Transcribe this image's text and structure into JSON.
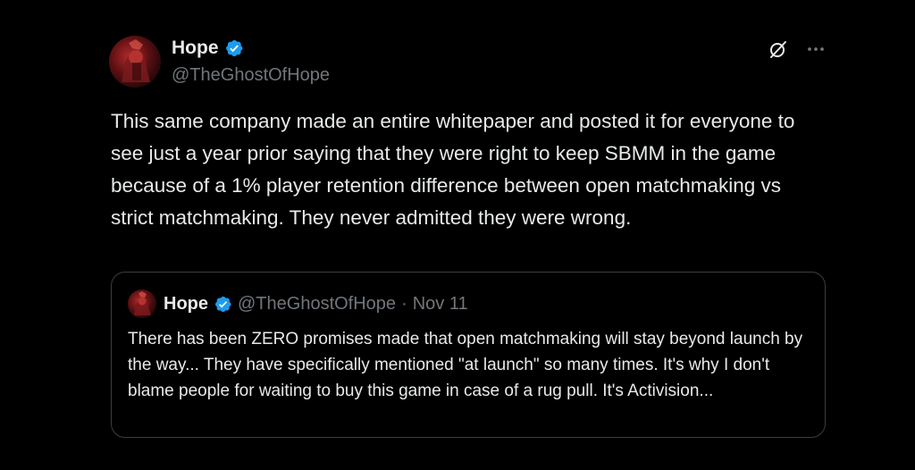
{
  "tweet": {
    "author": {
      "display_name": "Hope",
      "handle": "@TheGhostOfHope",
      "verified": true
    },
    "text": "This same company made an entire whitepaper and posted it for everyone to see just a year prior saying that they were right to keep SBMM in the game because of a 1% player retention difference between open matchmaking vs strict matchmaking. They never admitted they were wrong.",
    "icons": {
      "grok": "grok-icon",
      "more": "more-options-icon"
    },
    "more_label": "···"
  },
  "quote": {
    "author": {
      "display_name": "Hope",
      "handle": "@TheGhostOfHope",
      "verified": true
    },
    "separator": "·",
    "date": "Nov 11",
    "text": "There has been ZERO promises made that open matchmaking will stay beyond launch by the way... They have specifically mentioned \"at launch\" so many times. It's why I don't blame people for waiting to buy this game in case of a rug pull. It's Activision..."
  },
  "colors": {
    "background": "#000000",
    "text_primary": "#e7e9ea",
    "text_secondary": "#71767b",
    "verified_blue": "#1d9bf0",
    "border": "#3a3d41"
  }
}
